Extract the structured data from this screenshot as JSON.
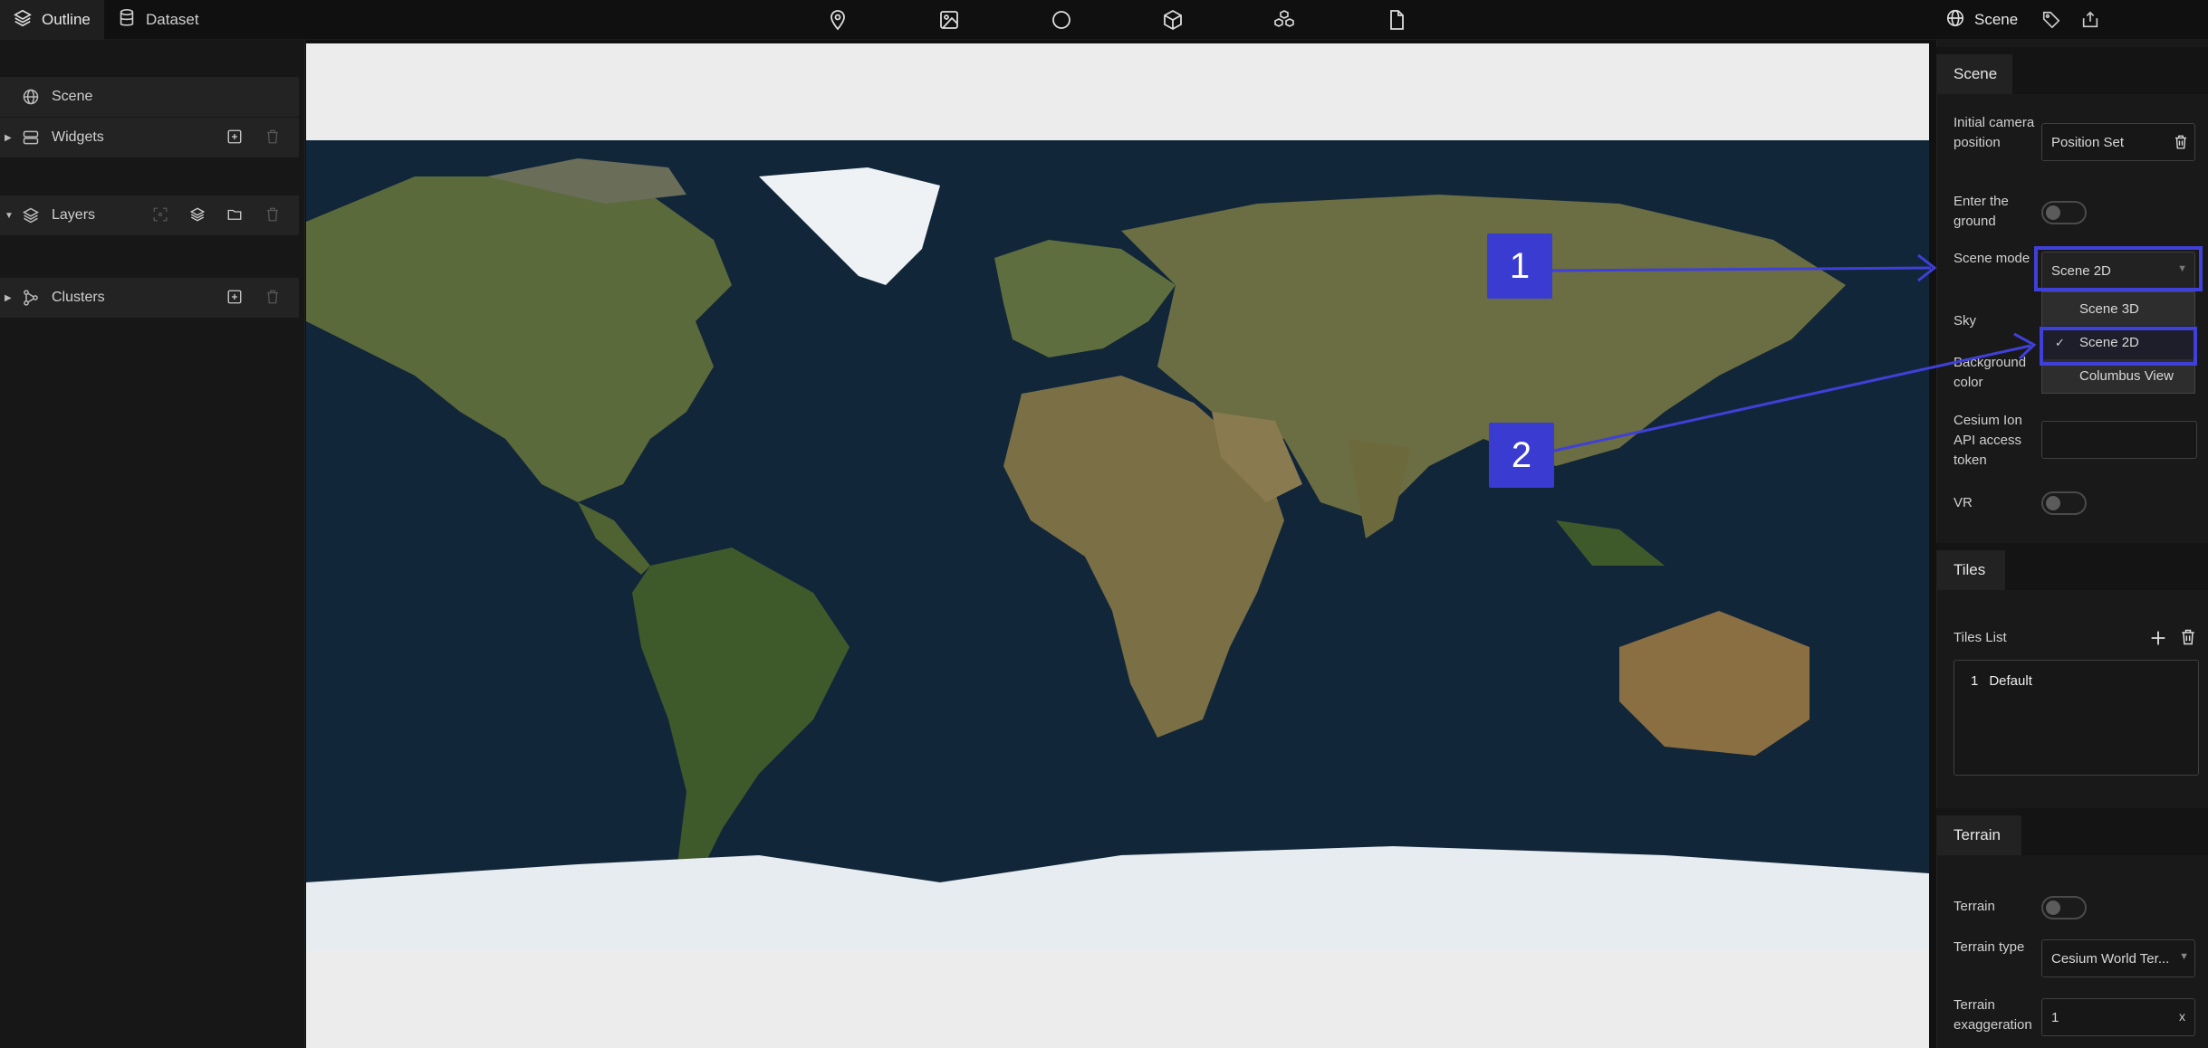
{
  "topbar": {
    "left_tabs": [
      {
        "label": "Outline",
        "icon": "layers-icon",
        "active": true
      },
      {
        "label": "Dataset",
        "icon": "database-icon",
        "active": false
      }
    ],
    "tools": [
      "map-pin-icon",
      "image-icon",
      "circle-icon",
      "cube-icon",
      "cubes-icon",
      "file-icon"
    ],
    "right_tabs": [
      {
        "label": "Scene",
        "icon": "globe-icon"
      },
      {
        "label": "",
        "icon": "tag-icon"
      },
      {
        "label": "",
        "icon": "export-icon"
      }
    ]
  },
  "outline": {
    "scene": {
      "label": "Scene",
      "icon": "globe-icon"
    },
    "widgets": {
      "label": "Widgets",
      "icon": "server-icon"
    },
    "layers": {
      "label": "Layers",
      "icon": "layers-icon"
    },
    "clusters": {
      "label": "Clusters",
      "icon": "cluster-icon"
    }
  },
  "scene_panel": {
    "title": "Scene",
    "initial_camera": {
      "label": "Initial camera position",
      "value": "Position Set"
    },
    "enter_ground": {
      "label": "Enter the ground",
      "on": false
    },
    "scene_mode": {
      "label": "Scene mode",
      "value": "Scene 2D",
      "options": [
        "Scene 3D",
        "Scene 2D",
        "Columbus View"
      ],
      "selected": "Scene 2D"
    },
    "sky": {
      "label": "Sky"
    },
    "background_color": {
      "label": "Background color"
    },
    "cesium_token": {
      "label": "Cesium Ion API access token",
      "value": ""
    },
    "vr": {
      "label": "VR",
      "on": false
    }
  },
  "tiles_panel": {
    "title": "Tiles",
    "list_label": "Tiles List",
    "items": [
      {
        "index": "1",
        "name": "Default"
      }
    ]
  },
  "terrain_panel": {
    "title": "Terrain",
    "terrain": {
      "label": "Terrain",
      "on": false
    },
    "terrain_type": {
      "label": "Terrain type",
      "value": "Cesium World Ter..."
    },
    "exaggeration": {
      "label": "Terrain exaggeration",
      "value": "1",
      "clear": "x"
    }
  },
  "annotations": {
    "badge1": "1",
    "badge2": "2"
  },
  "colors": {
    "accent": "#3a3bd0",
    "ocean": "#0f2236",
    "land": "#5c6a3a",
    "ice": "#e8eef2"
  }
}
